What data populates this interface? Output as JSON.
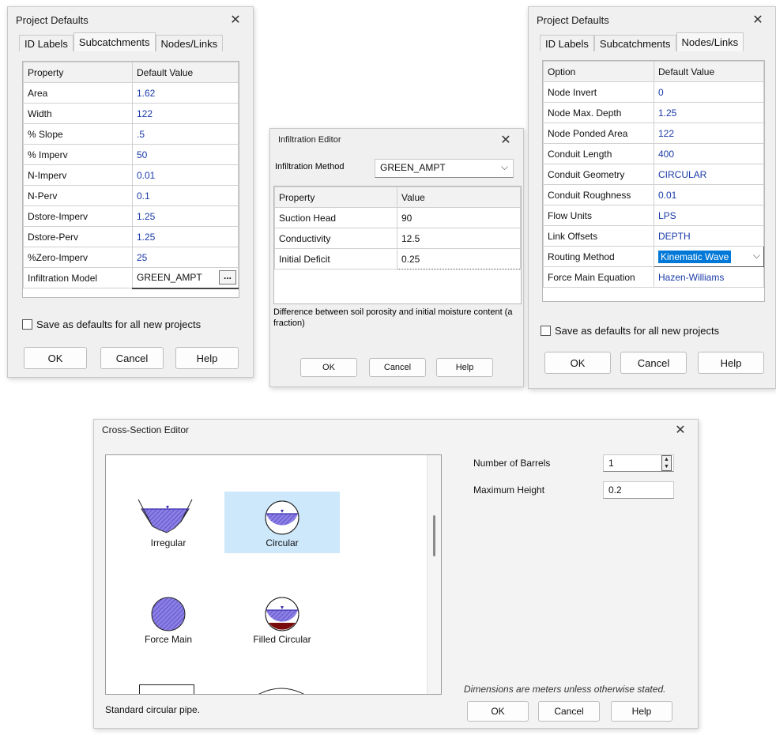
{
  "colors": {
    "value_text": "#1a3aa8",
    "selection": "#0078d7",
    "hatch": "#7b6bd9",
    "filled": "#7a0b0b",
    "selected_cell": "#cde8fb"
  },
  "pd1": {
    "title": "Project Defaults",
    "tabs": [
      "ID Labels",
      "Subcatchments",
      "Nodes/Links"
    ],
    "headers": [
      "Property",
      "Default Value"
    ],
    "rows": [
      {
        "k": "Area",
        "v": "1.62"
      },
      {
        "k": "Width",
        "v": "122"
      },
      {
        "k": "% Slope",
        "v": ".5"
      },
      {
        "k": "% Imperv",
        "v": "50"
      },
      {
        "k": "N-Imperv",
        "v": "0.01"
      },
      {
        "k": "N-Perv",
        "v": "0.1"
      },
      {
        "k": "Dstore-Imperv",
        "v": "1.25"
      },
      {
        "k": "Dstore-Perv",
        "v": "1.25"
      },
      {
        "k": "%Zero-Imperv",
        "v": "25"
      },
      {
        "k": "Infiltration Model",
        "v": "GREEN_AMPT"
      }
    ],
    "ellipsis": "...",
    "save_label": "Save as defaults for all new projects",
    "ok": "OK",
    "cancel": "Cancel",
    "help": "Help"
  },
  "infil": {
    "title": "Infiltration Editor",
    "method_label": "Infiltration Method",
    "method_value": "GREEN_AMPT",
    "headers": [
      "Property",
      "Value"
    ],
    "rows": [
      {
        "k": "Suction Head",
        "v": "90"
      },
      {
        "k": "Conductivity",
        "v": "12.5"
      },
      {
        "k": "Initial Deficit",
        "v": "0.25"
      }
    ],
    "description": "Difference between soil porosity and initial moisture content (a fraction)",
    "ok": "OK",
    "cancel": "Cancel",
    "help": "Help"
  },
  "pd2": {
    "title": "Project Defaults",
    "tabs": [
      "ID Labels",
      "Subcatchments",
      "Nodes/Links"
    ],
    "headers": [
      "Option",
      "Default Value"
    ],
    "rows": [
      {
        "k": "Node Invert",
        "v": "0"
      },
      {
        "k": "Node Max. Depth",
        "v": "1.25"
      },
      {
        "k": "Node Ponded Area",
        "v": "122"
      },
      {
        "k": "Conduit Length",
        "v": "400"
      },
      {
        "k": "Conduit Geometry",
        "v": "CIRCULAR"
      },
      {
        "k": "Conduit Roughness",
        "v": "0.01"
      },
      {
        "k": "Flow Units",
        "v": "LPS"
      },
      {
        "k": "Link Offsets",
        "v": "DEPTH"
      },
      {
        "k": "Routing Method",
        "v": "Kinematic Wave"
      },
      {
        "k": "Force Main Equation",
        "v": "Hazen-Williams"
      }
    ],
    "save_label": "Save as defaults for all new projects",
    "ok": "OK",
    "cancel": "Cancel",
    "help": "Help"
  },
  "xs": {
    "title": "Cross-Section Editor",
    "shapes": [
      "Irregular",
      "Circular",
      "Force Main",
      "Filled Circular"
    ],
    "selected_shape": "Circular",
    "barrels_label": "Number of Barrels",
    "barrels_value": "1",
    "height_label": "Maximum Height",
    "height_value": "0.2",
    "note": "Dimensions are meters unless otherwise stated.",
    "description": "Standard circular pipe.",
    "ok": "OK",
    "cancel": "Cancel",
    "help": "Help"
  }
}
